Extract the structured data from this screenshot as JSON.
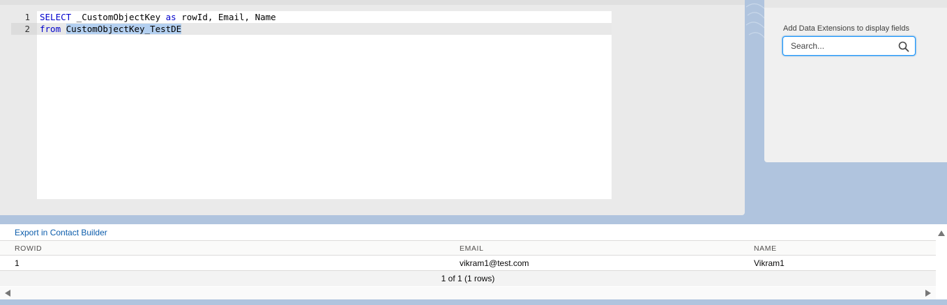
{
  "editor": {
    "lines": [
      {
        "number": "1"
      },
      {
        "number": "2"
      }
    ],
    "line1": {
      "kw_select": "SELECT",
      "rest1": " _CustomObjectKey ",
      "kw_as": "as",
      "rest2": " rowId, Email, Name"
    },
    "line2": {
      "kw_from": "from",
      "space": " ",
      "selected": "CustomObjectKey_TestDE"
    }
  },
  "fields_panel": {
    "label": "Add Data Extensions to display fields",
    "search_placeholder": "Search..."
  },
  "results": {
    "export_label": "Export in Contact Builder",
    "columns": [
      "ROWID",
      "EMAIL",
      "NAME"
    ],
    "rows": [
      [
        "1",
        "vikram1@test.com",
        "Vikram1"
      ]
    ],
    "pagination": "1 of 1 (1 rows)"
  },
  "colors": {
    "background": "#b0c4de",
    "accent": "#0b5cab",
    "keyword": "#0000cc",
    "selection": "#b4d0f0"
  }
}
